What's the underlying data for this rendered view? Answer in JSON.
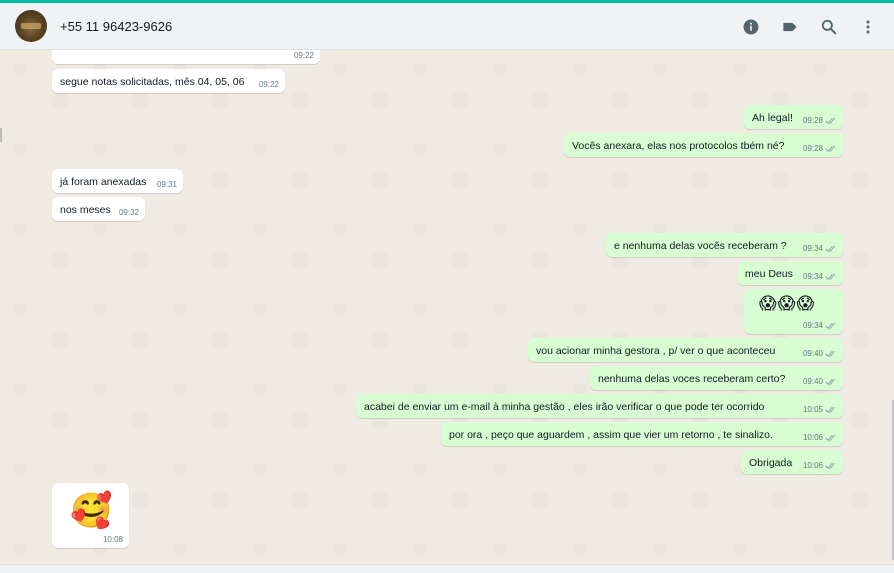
{
  "contact": {
    "name": "+55 11 96423-9626"
  },
  "header_icons": [
    "info-icon",
    "label-icon",
    "search-icon",
    "menu-icon"
  ],
  "colors": {
    "accent": "#00bfa5",
    "incoming": "#ffffff",
    "outgoing": "#d9fdd3",
    "tick": "#8696a0"
  },
  "messages": [
    {
      "dir": "in",
      "text": "",
      "time": "09:22"
    },
    {
      "dir": "in",
      "text": "segue notas solicitadas, mês 04, 05, 06",
      "time": "09:22"
    },
    {
      "dir": "out",
      "text": "Ah legal!",
      "time": "09:28"
    },
    {
      "dir": "out",
      "text": "Vocês anexara, elas nos protocolos tbém né?",
      "time": "09:28"
    },
    {
      "dir": "in",
      "text": "já foram anexadas",
      "time": "09:31"
    },
    {
      "dir": "in",
      "text": "nos meses",
      "time": "09:32"
    },
    {
      "dir": "out",
      "text": "e nenhuma delas vocês receberam ?",
      "time": "09:34"
    },
    {
      "dir": "out",
      "text": "meu Deus",
      "time": "09:34"
    },
    {
      "dir": "out",
      "text": "😱😱😱",
      "time": "09:34"
    },
    {
      "dir": "out",
      "text": "vou acionar minha gestora , p/ ver o que aconteceu",
      "time": "09:40"
    },
    {
      "dir": "out",
      "text": "nenhuma delas voces receberam certo?",
      "time": "09:40"
    },
    {
      "dir": "out",
      "text": "acabei de enviar um e-mail à minha gestão , eles irão verificar o que pode ter ocorrido",
      "time": "10:05"
    },
    {
      "dir": "out",
      "text": "por ora , peço que aguardem , assim que vier um retorno , te sinalizo.",
      "time": "10:06"
    },
    {
      "dir": "out",
      "text": "Obrigada",
      "time": "10:06"
    },
    {
      "dir": "in",
      "text": "🥰",
      "time": "10:08"
    }
  ]
}
